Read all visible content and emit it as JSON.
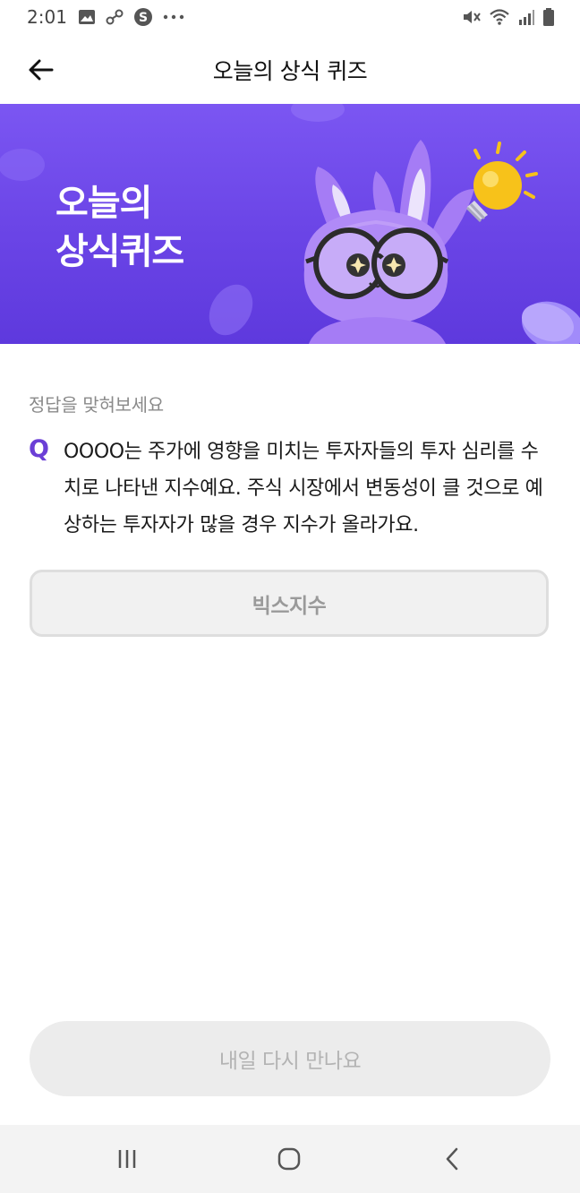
{
  "status_bar": {
    "time": "2:01",
    "left_icons": [
      "image-icon",
      "link-icon",
      "s-badge-icon",
      "more-dots-icon"
    ],
    "right_icons": [
      "mute-icon",
      "wifi-icon",
      "signal-icon",
      "battery-icon"
    ]
  },
  "header": {
    "title": "오늘의 상식 퀴즈",
    "back_icon": "arrow-left-icon"
  },
  "banner": {
    "title": "오늘의\n상식퀴즈",
    "background_color": "#6a44e6",
    "illustration": "purple-rabbit-with-glasses-and-lightbulb"
  },
  "quiz": {
    "instruction": "정답을 맞혀보세요",
    "q_label": "Q",
    "question": "OOOO는 주가에 영향을 미치는 투자자들의 투자 심리를 수치로 나타낸 지수예요. 주식 시장에서 변동성이 클 것으로 예상하는 투자자가 많을 경우 지수가 올라가요.",
    "answer": "빅스지수",
    "accent_color": "#6b3fd6"
  },
  "cta": {
    "label": "내일 다시 만나요"
  },
  "nav_bar": {
    "icons": [
      "recent-apps-icon",
      "home-icon",
      "back-icon"
    ]
  }
}
